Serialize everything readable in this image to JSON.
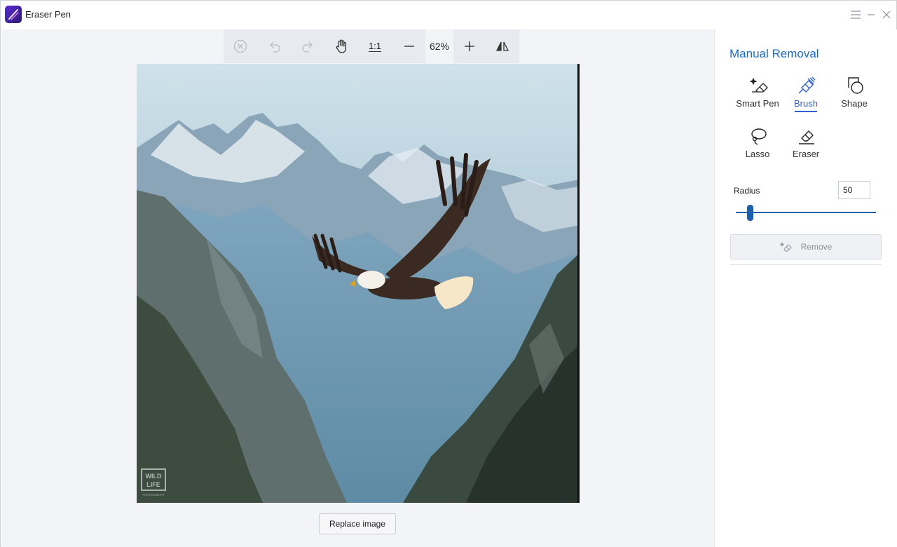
{
  "app": {
    "title": "Eraser Pen",
    "logo_icon": "pen-logo-icon"
  },
  "window_controls": {
    "menu_icon": "hamburger-menu-icon",
    "minimize_icon": "minimize-icon",
    "close_icon": "close-icon"
  },
  "toolbar": {
    "clear_icon": "close-circle-icon",
    "undo_icon": "undo-icon",
    "redo_icon": "redo-icon",
    "pan_icon": "hand-icon",
    "actual_size_label": "1:1",
    "zoom_out_icon": "minus-icon",
    "zoom_level": "62%",
    "zoom_in_icon": "plus-icon",
    "flip_icon": "flip-icon"
  },
  "canvas": {
    "image_description": "bald-eagle-over-mountains",
    "watermark_text": "WILD LIFE",
    "watermark_subtext": "PHOTOGRAPHY",
    "replace_button_label": "Replace image"
  },
  "panel": {
    "title": "Manual Removal",
    "tools": [
      {
        "label": "Smart Pen",
        "icon": "smart-pen-icon",
        "active": false
      },
      {
        "label": "Brush",
        "icon": "brush-icon",
        "active": true
      },
      {
        "label": "Shape",
        "icon": "shape-icon",
        "active": false
      },
      {
        "label": "Lasso",
        "icon": "lasso-icon",
        "active": false
      },
      {
        "label": "Eraser",
        "icon": "eraser-icon",
        "active": false
      }
    ],
    "radius_label": "Radius",
    "radius_value": "50",
    "radius_slider_fraction": 0.1,
    "remove_button_label": "Remove",
    "remove_enabled": false
  },
  "colors": {
    "accent": "#2f5fd0",
    "title_blue": "#1e6ac9",
    "slider": "#1d5fa8",
    "canvas_bg": "#f3f4f8",
    "toolbar_bg": "#e9eaef"
  }
}
